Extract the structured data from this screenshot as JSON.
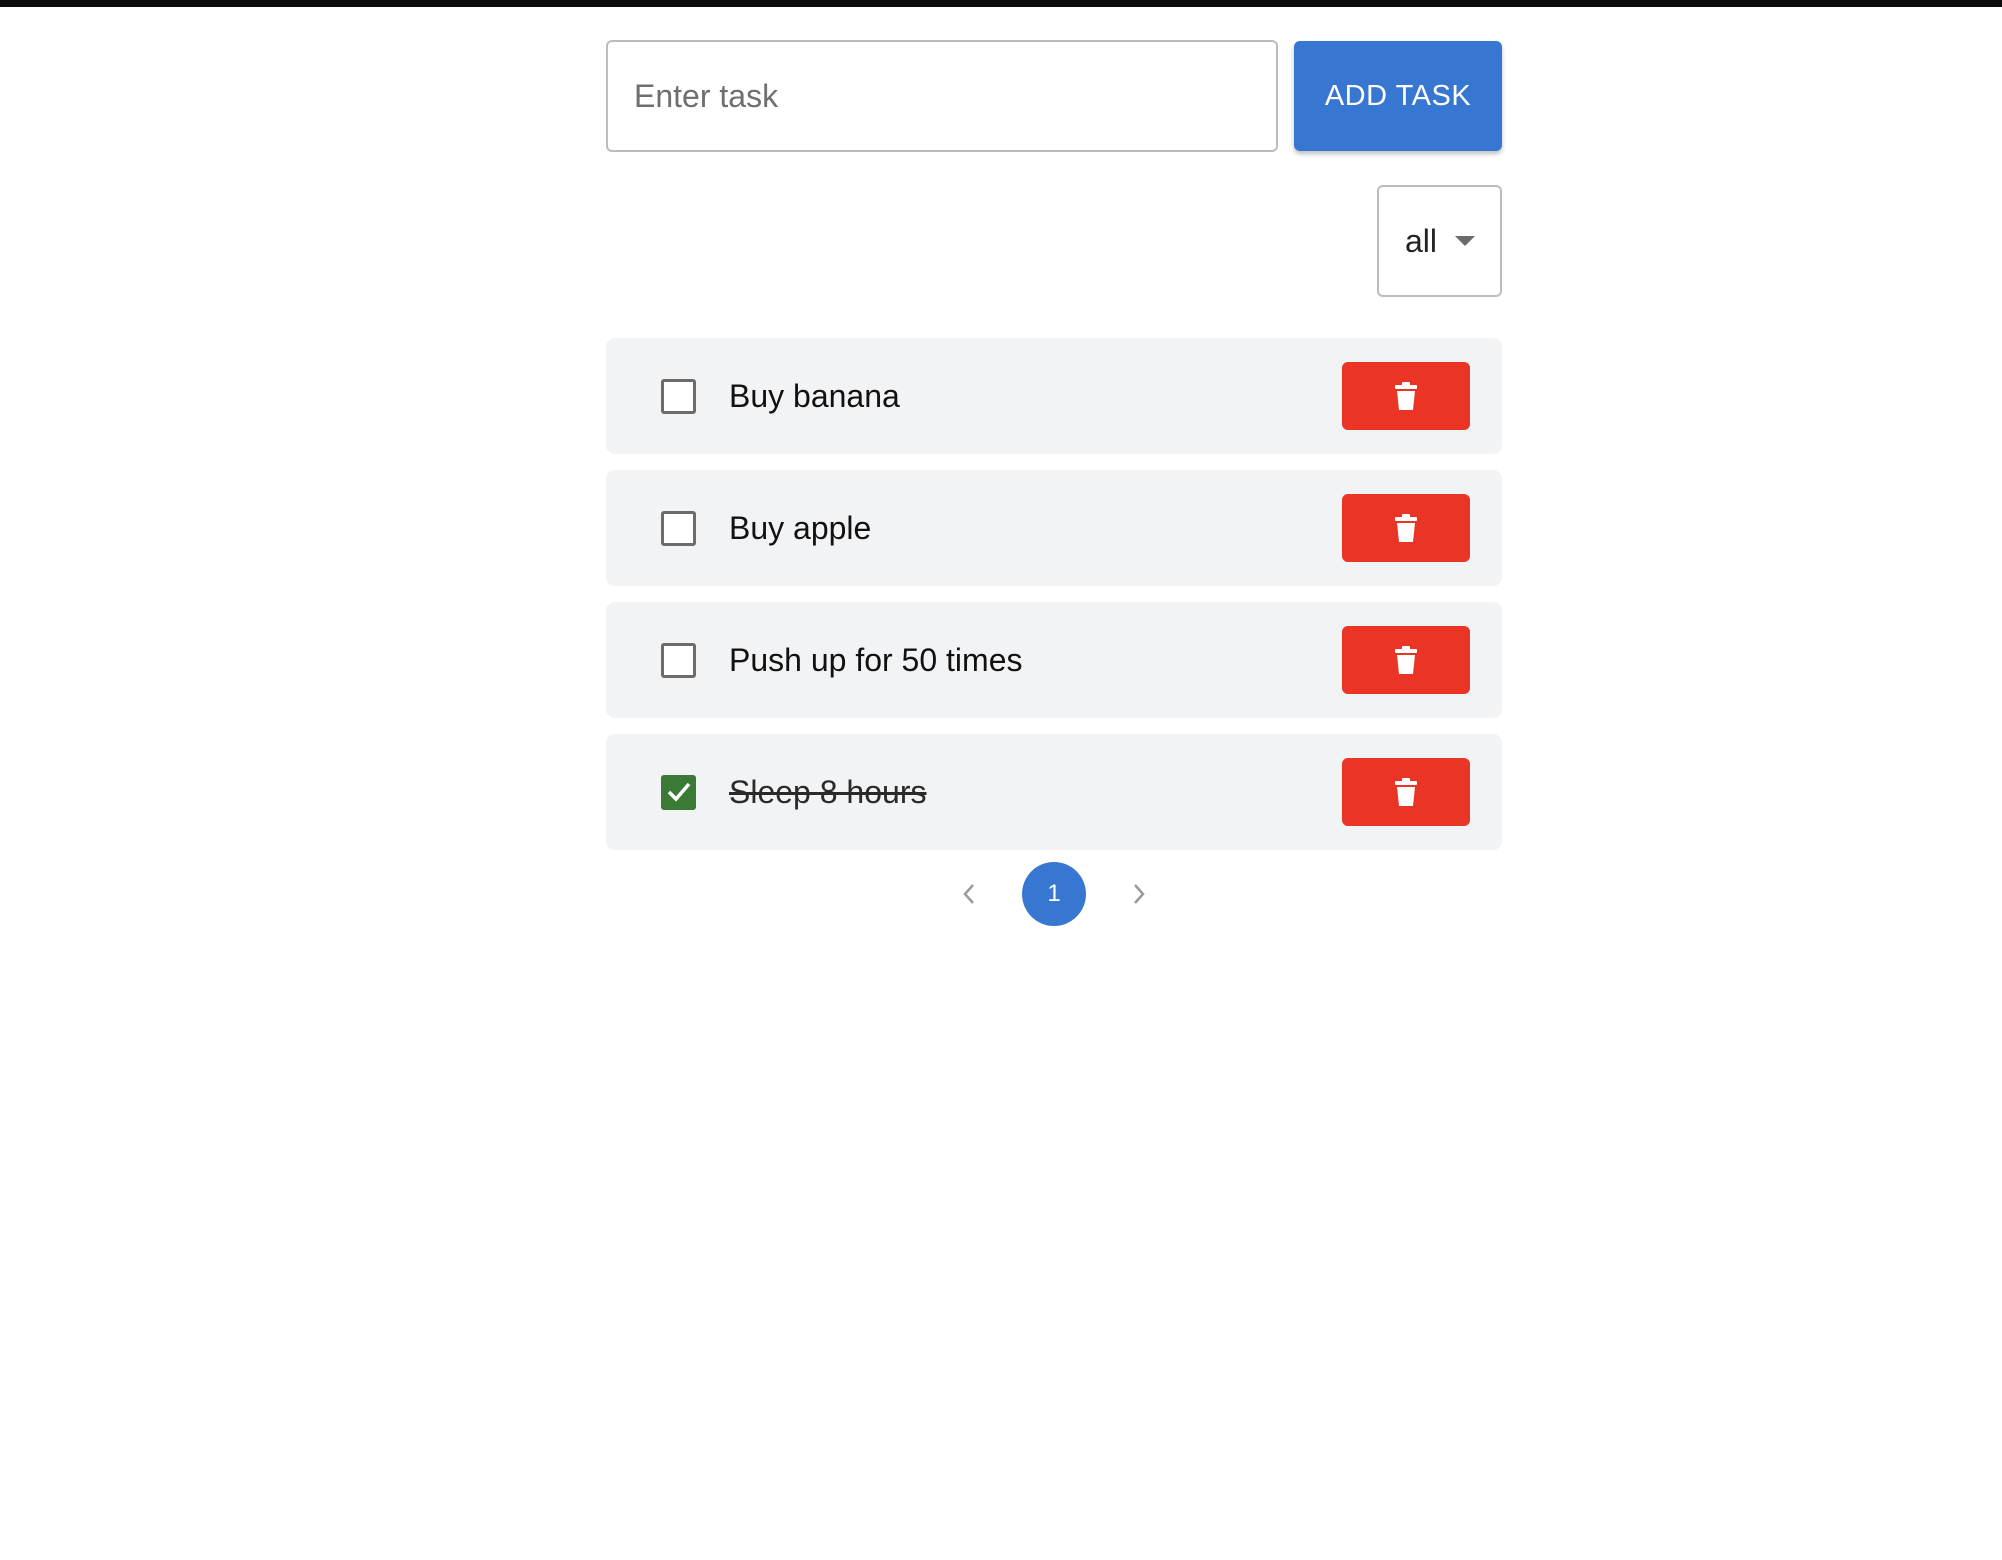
{
  "input": {
    "placeholder": "Enter task",
    "value": ""
  },
  "add_button": {
    "label": "ADD TASK",
    "color": "#3776d1"
  },
  "filter": {
    "selected": "all"
  },
  "tasks": [
    {
      "text": "Buy banana",
      "completed": false
    },
    {
      "text": "Buy apple",
      "completed": false
    },
    {
      "text": "Push up for 50 times",
      "completed": false
    },
    {
      "text": "Sleep 8 hours",
      "completed": true
    }
  ],
  "icons": {
    "delete": "trash-icon",
    "checkbox_checked": "check-icon",
    "prev": "chevron-left-icon",
    "next": "chevron-right-icon",
    "filter_caret": "caret-down-icon"
  },
  "colors": {
    "delete_button": "#ea3426",
    "checked_checkbox": "#3a7a35",
    "active_page": "#3776d1"
  },
  "pagination": {
    "current_page": "1"
  }
}
